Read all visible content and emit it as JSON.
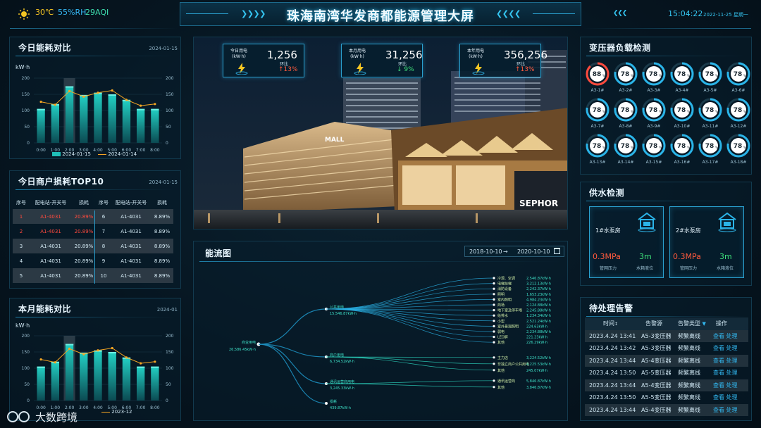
{
  "header": {
    "title": "珠海南湾华发商都能源管理大屏",
    "temperature": "30℃",
    "humidity": "55%RH",
    "aqi": "29AQI",
    "time": "15:04:22",
    "date": "2022-11-25 星期一"
  },
  "colors": {
    "accent": "#29b8ee",
    "teal": "#1fd3c5",
    "orange": "#f5a623",
    "red": "#ff4a3d",
    "green": "#3ee07a"
  },
  "daily": {
    "title": "今日能耗对比",
    "date": "2024-01-15",
    "unit": "kW·h",
    "legend_bar": "2024-01-15",
    "legend_line": "2024-01-14"
  },
  "monthly": {
    "title": "本月能耗对比",
    "date": "2024-01",
    "unit": "kW·h",
    "legend_bar": "",
    "legend_line": "2023-12"
  },
  "chart_data": [
    {
      "type": "bar",
      "title": "今日能耗对比",
      "ylabel": "kW·h",
      "ylim": [
        0,
        200
      ],
      "yticks": [
        0,
        50,
        100,
        150,
        200
      ],
      "categories": [
        "0:00",
        "1:00",
        "2:00",
        "3:00",
        "4:00",
        "5:00",
        "6:00",
        "7:00",
        "8:00"
      ],
      "series": [
        {
          "name": "2024-01-15",
          "type": "bar",
          "values": [
            105,
            120,
            175,
            148,
            155,
            150,
            133,
            105,
            105
          ]
        },
        {
          "name": "2024-01-14",
          "type": "line",
          "values": [
            127,
            118,
            160,
            143,
            155,
            162,
            133,
            115,
            120
          ]
        }
      ]
    },
    {
      "type": "bar",
      "title": "本月能耗对比",
      "ylabel": "kW·h",
      "ylim": [
        0,
        200
      ],
      "yticks": [
        0,
        50,
        100,
        150,
        200
      ],
      "categories": [
        "0:00",
        "1:00",
        "2:00",
        "3:00",
        "4:00",
        "5:00",
        "6:00",
        "7:00",
        "8:00"
      ],
      "series": [
        {
          "name": "",
          "type": "bar",
          "values": [
            105,
            120,
            175,
            148,
            155,
            150,
            133,
            105,
            105
          ]
        },
        {
          "name": "2023-12",
          "type": "line",
          "values": [
            127,
            118,
            160,
            143,
            155,
            162,
            133,
            115,
            120
          ]
        }
      ]
    }
  ],
  "rank": {
    "title": "今日商户损耗TOP10",
    "date": "2024-01-15",
    "headers": [
      "序号",
      "配电站-开关号",
      "损耗"
    ],
    "left": [
      {
        "no": "1",
        "code": "A1-4031",
        "val": "20.89%"
      },
      {
        "no": "2",
        "code": "A1-4031",
        "val": "20.89%"
      },
      {
        "no": "3",
        "code": "A1-4031",
        "val": "20.89%"
      },
      {
        "no": "4",
        "code": "A1-4031",
        "val": "20.89%"
      },
      {
        "no": "5",
        "code": "A1-4031",
        "val": "20.89%"
      }
    ],
    "right": [
      {
        "no": "6",
        "code": "A1-4031",
        "val": "8.89%"
      },
      {
        "no": "7",
        "code": "A1-4031",
        "val": "8.89%"
      },
      {
        "no": "8",
        "code": "A1-4031",
        "val": "8.89%"
      },
      {
        "no": "9",
        "code": "A1-4031",
        "val": "8.89%"
      },
      {
        "no": "10",
        "code": "A1-4031",
        "val": "8.89%"
      }
    ]
  },
  "stats": [
    {
      "caption1": "今日用电",
      "caption2": "(kW·h)",
      "value": "1,256",
      "hb": "环比",
      "pct": "↑13%",
      "color": "#ff5a3d"
    },
    {
      "caption1": "本月用电",
      "caption2": "(kW·h)",
      "value": "31,256",
      "hb": "环比",
      "pct": "↓ 9%",
      "color": "#3ee07a"
    },
    {
      "caption1": "本年用电",
      "caption2": "(kW·h)",
      "value": "356,256",
      "hb": "环比",
      "pct": "↑13%",
      "color": "#ff5a3d"
    }
  ],
  "building": {
    "mall_sign": "MALL",
    "sephora": "SEPHOR"
  },
  "flow": {
    "title": "能流图",
    "date_from": "2018-10-10",
    "arrow": "→",
    "date_to": "2020-10-10",
    "root": {
      "name": "商业用电",
      "value": "26,586.45kW·h"
    },
    "branches": [
      {
        "name": "公共用电",
        "value": "15,546.87kW·h",
        "leaves": [
          {
            "n": "冷源、空调",
            "v": "2,546.87kW·h"
          },
          {
            "n": "电梯扶梯",
            "v": "3,212.13kW·h"
          },
          {
            "n": "消防设备",
            "v": "2,242.37kW·h"
          },
          {
            "n": "照明",
            "v": "1,653.23kW·h"
          },
          {
            "n": "室内照明",
            "v": "4,984.23kW·h"
          },
          {
            "n": "商场",
            "v": "2,124.88kW·h"
          },
          {
            "n": "地下室及停车场",
            "v": "2,245.88kW·h"
          },
          {
            "n": "给排水",
            "v": "1,234.34kW·h"
          },
          {
            "n": "小型",
            "v": "2,521.24kW·h"
          },
          {
            "n": "室外景观照明",
            "v": "224.63kW·h"
          },
          {
            "n": "弱电",
            "v": "2,234.88kW·h"
          },
          {
            "n": "LED屏",
            "v": "221.23kW·h"
          },
          {
            "n": "其他",
            "v": "226.29kW·h"
          }
        ]
      },
      {
        "name": "商户用电",
        "value": "6,734.52kW·h",
        "leaves": [
          {
            "n": "主力店",
            "v": "3,224.52kW·h"
          },
          {
            "n": "非独立商户公共用电",
            "v": "4,225.53kW·h"
          },
          {
            "n": "其他",
            "v": "245.07kW·h"
          }
        ]
      },
      {
        "name": "通讯运营商用电",
        "value": "3,245.33kW·h",
        "leaves": [
          {
            "n": "通讯运营商",
            "v": "5,846.87kW·h"
          },
          {
            "n": "其他",
            "v": "3,846.87kW·h"
          }
        ]
      },
      {
        "name": "损耗",
        "value": "439.87kW·h",
        "leaves": []
      }
    ]
  },
  "transformer": {
    "title": "变压器负载检测",
    "items": [
      {
        "v": "88",
        "u": "%",
        "n": "A3-1#",
        "alert": true
      },
      {
        "v": "78",
        "u": "%",
        "n": "A3-2#",
        "alert": false
      },
      {
        "v": "78",
        "u": "%",
        "n": "A3-3#",
        "alert": false
      },
      {
        "v": "78",
        "u": "%",
        "n": "A3-4#",
        "alert": false
      },
      {
        "v": "78",
        "u": "%",
        "n": "A3-5#",
        "alert": false
      },
      {
        "v": "78",
        "u": "%",
        "n": "A3-6#",
        "alert": false
      },
      {
        "v": "78",
        "u": "%",
        "n": "A3-7#",
        "alert": false
      },
      {
        "v": "78",
        "u": "%",
        "n": "A3-8#",
        "alert": false
      },
      {
        "v": "78",
        "u": "%",
        "n": "A3-9#",
        "alert": false
      },
      {
        "v": "78",
        "u": "%",
        "n": "A3-10#",
        "alert": false
      },
      {
        "v": "78",
        "u": "%",
        "n": "A3-11#",
        "alert": false
      },
      {
        "v": "78",
        "u": "%",
        "n": "A3-12#",
        "alert": false
      },
      {
        "v": "78",
        "u": "%",
        "n": "A3-13#",
        "alert": false
      },
      {
        "v": "78",
        "u": "%",
        "n": "A3-14#",
        "alert": false
      },
      {
        "v": "78",
        "u": "%",
        "n": "A3-15#",
        "alert": false
      },
      {
        "v": "78",
        "u": "%",
        "n": "A3-16#",
        "alert": false
      },
      {
        "v": "78",
        "u": "%",
        "n": "A3-17#",
        "alert": false
      },
      {
        "v": "78",
        "u": "%",
        "n": "A3-18#",
        "alert": false
      }
    ]
  },
  "water": {
    "title": "供水检测",
    "rooms": [
      {
        "name": "1#水泵房",
        "pressure": "0.3MPa",
        "pressure_label": "管网压力",
        "level": "3m",
        "level_label": "水箱液位"
      },
      {
        "name": "2#水泵房",
        "pressure": "0.3MPa",
        "pressure_label": "管网压力",
        "level": "3m",
        "level_label": "水箱液位"
      }
    ]
  },
  "alarms": {
    "title": "待处理告警",
    "headers": {
      "time": "时间",
      "sort": "↕",
      "source": "告警源",
      "type": "告警类型",
      "filter": "▼",
      "op": "操作"
    },
    "rows": [
      {
        "time": "2023.4.24 13:41",
        "src": "A5-3变压器",
        "type": "频繁离线",
        "a": "查看",
        "b": "处理"
      },
      {
        "time": "2023.4.24 13:42",
        "src": "A5-3变压器",
        "type": "频繁离线",
        "a": "查看",
        "b": "处理"
      },
      {
        "time": "2023.4.24 13:44",
        "src": "A5-4变压器",
        "type": "频繁离线",
        "a": "查看",
        "b": "处理"
      },
      {
        "time": "2023.4.24 13:50",
        "src": "A5-5变压器",
        "type": "频繁离线",
        "a": "查看",
        "b": "处理"
      },
      {
        "time": "2023.4.24 13:44",
        "src": "A5-4变压器",
        "type": "频繁离线",
        "a": "查看",
        "b": "处理"
      },
      {
        "time": "2023.4.24 13:50",
        "src": "A5-5变压器",
        "type": "频繁离线",
        "a": "查看",
        "b": "处理"
      },
      {
        "time": "2023.4.24 13:44",
        "src": "A5-4变压器",
        "type": "频繁离线",
        "a": "查看",
        "b": "处理"
      }
    ]
  },
  "watermark": {
    "text": "大数跨境"
  }
}
